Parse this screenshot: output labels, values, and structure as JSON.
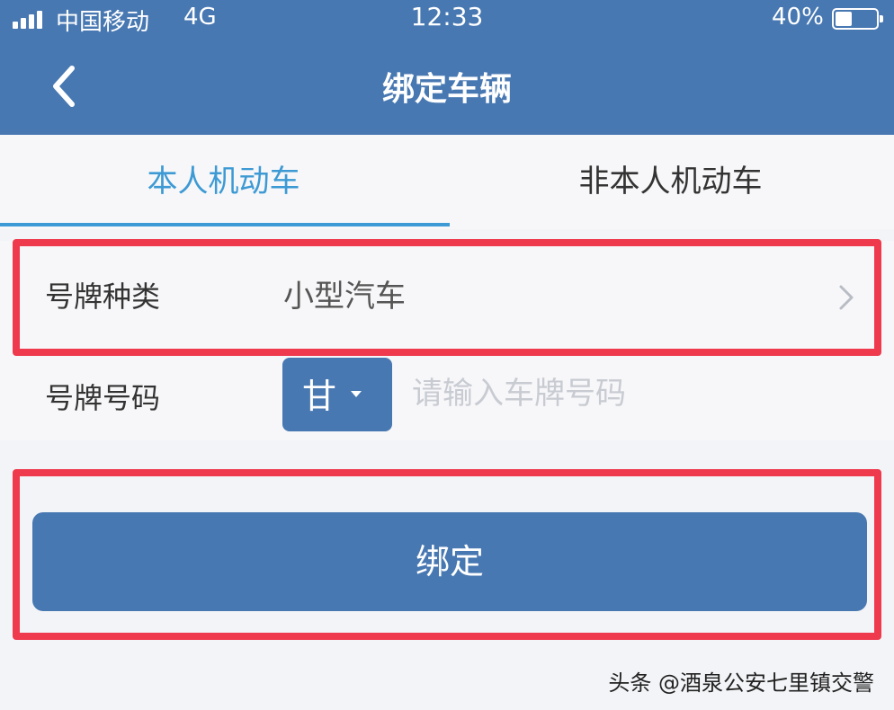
{
  "status_bar": {
    "carrier": "中国移动",
    "network": "4G",
    "time": "12:33",
    "battery_percent": "40%",
    "battery_level": 0.4,
    "signal_bars": 4
  },
  "header": {
    "title": "绑定车辆",
    "back_icon": "chevron-left-icon",
    "background_color": "#4878b2"
  },
  "tabs": [
    {
      "label": "本人机动车",
      "active": true
    },
    {
      "label": "非本人机动车",
      "active": false
    }
  ],
  "form": {
    "plate_type": {
      "label": "号牌种类",
      "value": "小型汽车",
      "icon": "chevron-right-icon"
    },
    "plate_number": {
      "label": "号牌号码",
      "province": "甘",
      "placeholder": "请输入车牌号码",
      "value": ""
    }
  },
  "bind_button": {
    "label": "绑定"
  },
  "watermark": "头条 @酒泉公安七里镇交警",
  "colors": {
    "accent": "#4878b2",
    "tab_active": "#3d9ad4",
    "highlight": "#ef3a4e"
  }
}
